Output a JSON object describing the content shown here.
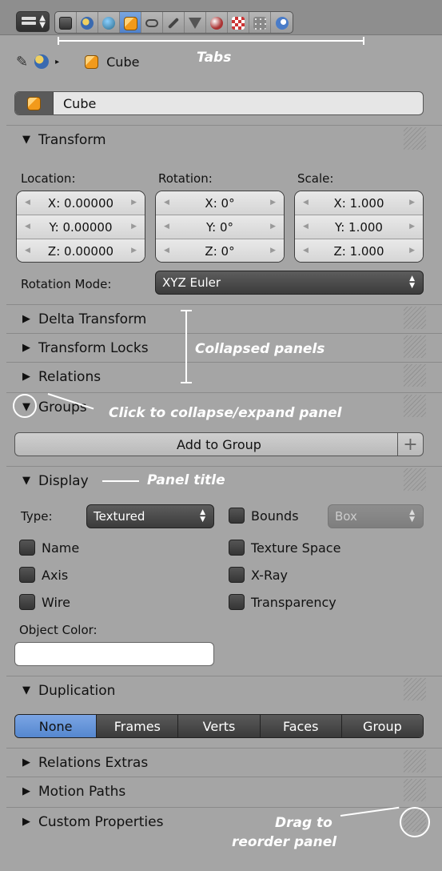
{
  "toolbar": {
    "tabs": [
      "render",
      "scene",
      "world",
      "object",
      "constraints",
      "modifiers",
      "data",
      "material",
      "texture",
      "particles",
      "physics"
    ],
    "active_tab": "object"
  },
  "annotations": {
    "tabs": "Tabs",
    "collapsed_panels": "Collapsed panels",
    "click_collapse": "Click to collapse/expand panel",
    "panel_title": "Panel title",
    "drag_reorder_1": "Drag to",
    "drag_reorder_2": "reorder panel"
  },
  "breadcrumb": {
    "object": "Cube"
  },
  "name_field": {
    "value": "Cube"
  },
  "transform": {
    "title": "Transform",
    "location_label": "Location:",
    "rotation_label": "Rotation:",
    "scale_label": "Scale:",
    "location": [
      "X: 0.00000",
      "Y: 0.00000",
      "Z: 0.00000"
    ],
    "rotation": [
      "X: 0°",
      "Y: 0°",
      "Z: 0°"
    ],
    "scale": [
      "X: 1.000",
      "Y: 1.000",
      "Z: 1.000"
    ],
    "rotation_mode_label": "Rotation Mode:",
    "rotation_mode": "XYZ Euler"
  },
  "panels": {
    "delta_transform": "Delta Transform",
    "transform_locks": "Transform Locks",
    "relations": "Relations",
    "groups": "Groups",
    "display": "Display",
    "duplication": "Duplication",
    "relations_extras": "Relations Extras",
    "motion_paths": "Motion Paths",
    "custom_properties": "Custom Properties"
  },
  "groups": {
    "add_button": "Add to Group"
  },
  "display": {
    "type_label": "Type:",
    "type_value": "Textured",
    "bounds_label": "Bounds",
    "bounds_value": "Box",
    "name": "Name",
    "axis": "Axis",
    "wire": "Wire",
    "texture_space": "Texture Space",
    "xray": "X-Ray",
    "transparency": "Transparency",
    "object_color_label": "Object Color:",
    "object_color": "#ffffff"
  },
  "duplication": {
    "options": [
      "None",
      "Frames",
      "Verts",
      "Faces",
      "Group"
    ],
    "active": "None"
  }
}
